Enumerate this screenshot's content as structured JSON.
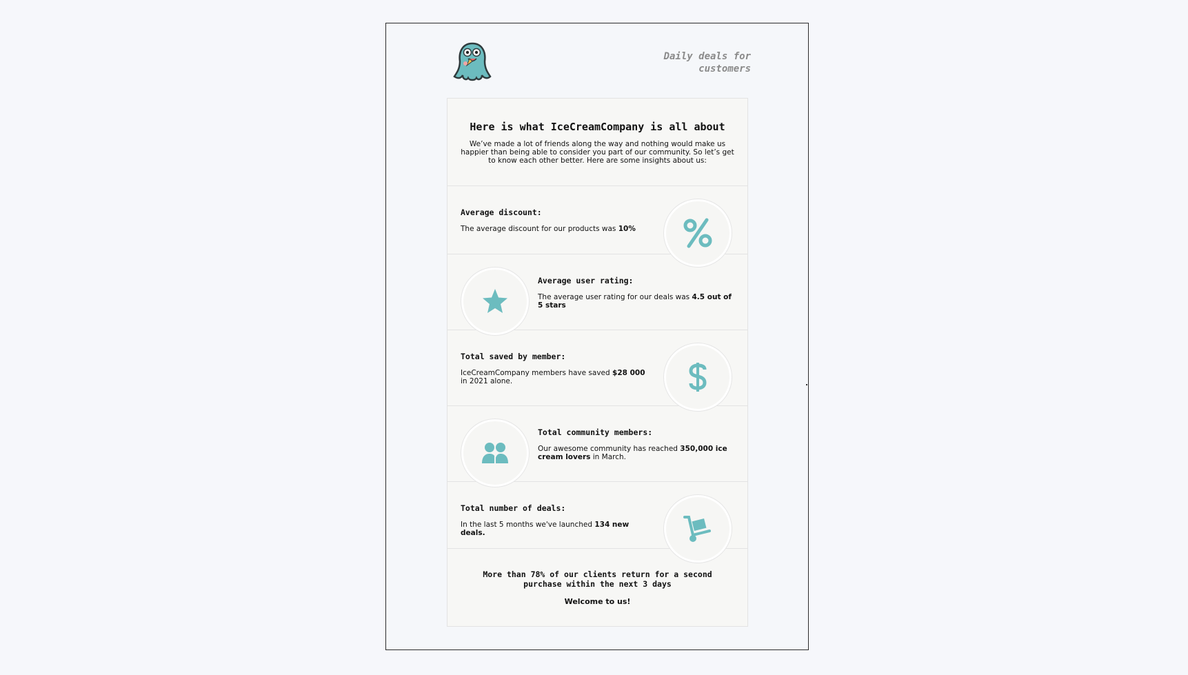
{
  "header": {
    "tagline": "Daily deals for customers",
    "logo_icon": "octopus-mascot-icon"
  },
  "intro": {
    "title": "Here is what IceCreamCompany is all about",
    "text": "We’ve made a lot of friends along the way and nothing would make us happier than being able to consider you part of our community. So let’s get to know each other better. Here are some insights about us:"
  },
  "stats": {
    "discount": {
      "title": "Average discount:",
      "text": "The average discount for our products was ",
      "value": "10%",
      "icon": "percent-icon"
    },
    "rating": {
      "title": "Average user rating:",
      "text": "The average user rating for our deals was ",
      "value": "4.5 out of 5 stars",
      "icon": "star-icon"
    },
    "saved": {
      "title": "Total saved by member:",
      "text": "IceCreamCompany members have saved ",
      "value": "$28 000",
      "text_after": " in 2021 alone.",
      "icon": "dollar-icon"
    },
    "members": {
      "title": "Total community members:",
      "text": "Our awesome community has reached ",
      "value": "350,000 ice cream lovers",
      "text_after": " in March.",
      "icon": "users-icon"
    },
    "deals": {
      "title": "Total number of deals:",
      "text": "In the last 5 months we've launched ",
      "value": "134 new deals.",
      "icon": "hand-truck-icon"
    }
  },
  "footer": {
    "line": "More than 78% of our clients return for a second purchase within the next 3 days",
    "welcome": "Welcome to us!"
  },
  "colors": {
    "accent": "#6cbcbf",
    "background": "#f6f7fb",
    "card": "#f7f7f5"
  }
}
